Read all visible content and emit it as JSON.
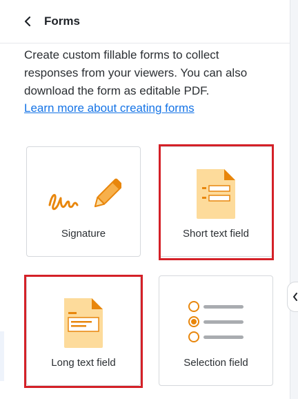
{
  "header": {
    "title": "Forms"
  },
  "description": "Create custom fillable forms to collect responses from your viewers. You can also download the form as editable PDF.",
  "learn_more_link": "Learn more about creating forms",
  "cards": [
    {
      "label": "Signature",
      "icon": "signature-icon",
      "highlighted": false
    },
    {
      "label": "Short text field",
      "icon": "short-text-field-icon",
      "highlighted": true
    },
    {
      "label": "Long text field",
      "icon": "long-text-field-icon",
      "highlighted": true
    },
    {
      "label": "Selection field",
      "icon": "selection-field-icon",
      "highlighted": false
    }
  ],
  "colors": {
    "highlight": "#d42027",
    "link": "#1473e6",
    "icon_orange": "#e8860c",
    "doc_fill": "#fddb9b"
  }
}
